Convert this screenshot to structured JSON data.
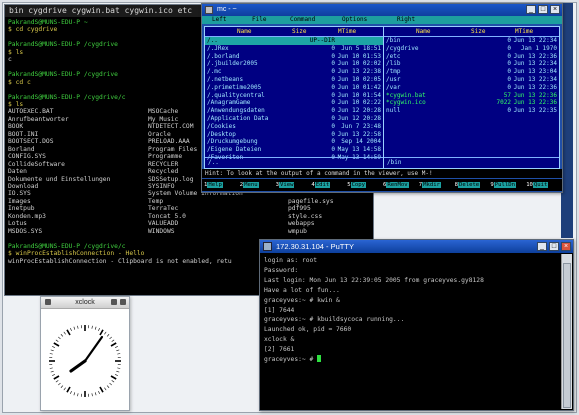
{
  "cygwin": {
    "title": "bin  cygdrive  cygwin.bat  cygwin.ico  etc",
    "lines": [
      "PakrandS@MUNS-EDU-P ~",
      "$ cd cygdrive",
      "",
      "PakrandS@MUNS-EDU-P /cygdrive",
      "$ ls",
      "c",
      "",
      "PakrandS@MUNS-EDU-P /cygdrive",
      "$ cd c",
      "",
      "PakrandS@MUNS-EDU-P /cygdrive/c",
      "$ ls"
    ],
    "listing_left": [
      "AUTOEXEC.BAT",
      "Anrufbeantworter",
      "BOOK",
      "BOOT.INI",
      "BOOTSECT.DOS",
      "Borland",
      "CONFIG.SYS",
      "CollideSoftware",
      "Daten",
      "Dokumente und Einstellungen",
      "Download",
      "IO.SYS",
      "Images",
      "Inetpub",
      "Konden.mp3",
      "Lotus",
      "MSDOS.SYS"
    ],
    "listing_right": [
      "MSOCache",
      "My Music",
      "NTDETECT.COM",
      "Oracle",
      "PRELOAD.AAA",
      "Program Files",
      "Programme",
      "RECYCLER",
      "Recycled",
      "SDSSetup.log",
      "SYSINFO",
      "System Volume Information",
      "Temp",
      "TerraTec",
      "Toncat 5.0",
      "VALUEADD",
      "WINDOWS"
    ],
    "listing_extra": [
      "pagefile.sys",
      "pdf995",
      "style.css",
      "webapps",
      "wmpub"
    ],
    "tail": [
      "",
      "PakrandS@MUNS-EDU-P /cygdrive/c",
      "$ winProcEstablishConnection - Hello",
      "winProcEstablishConnection - Clipboard is not enabled, retu"
    ]
  },
  "mc": {
    "title": "mc - ~",
    "menu": [
      "Left",
      "File",
      "Command",
      "Options",
      "Right"
    ],
    "left": {
      "headers": [
        "Name",
        "Size",
        "MTime"
      ],
      "rows": [
        [
          "/..",
          "UP--DIR",
          ""
        ],
        [
          "/.JRex",
          "0",
          "Jun  5 18:51"
        ],
        [
          "/.borland",
          "0",
          "Jun 10 01:53"
        ],
        [
          "/.jbuilder2005",
          "0",
          "Jun 10 02:02"
        ],
        [
          "/.mc",
          "0",
          "Jun 13 22:38"
        ],
        [
          "/.netbeans",
          "0",
          "Jun 10 02:05"
        ],
        [
          "/.primetime2005",
          "0",
          "Jun 10 01:42"
        ],
        [
          "/.qualitycentral",
          "0",
          "Jun 10 01:54"
        ],
        [
          "/AnagramGame",
          "0",
          "Jun 10 02:22"
        ],
        [
          "/Anwendungsdaten",
          "0",
          "Jun 12 20:28"
        ],
        [
          "/Application Data",
          "0",
          "Jun 12 20:28"
        ],
        [
          "/Cookies",
          "0",
          "Jun  7 23:48"
        ],
        [
          "/Desktop",
          "0",
          "Jun 13 22:58"
        ],
        [
          "/Druckumgebung",
          "0",
          "Sep 14  2004"
        ],
        [
          "/Eigene Dateien",
          "0",
          "May 13 14:58"
        ],
        [
          "/Favoriten",
          "0",
          "May 13 14:59"
        ]
      ],
      "footer": "/.."
    },
    "right": {
      "headers": [
        "Name",
        "Size",
        "MTime"
      ],
      "rows": [
        [
          "/bin",
          "0",
          "Jun 13 22:34"
        ],
        [
          "/cygdrive",
          "0",
          "Jan  1  1970"
        ],
        [
          "/etc",
          "0",
          "Jun 13 22:36"
        ],
        [
          "/lib",
          "0",
          "Jun 13 22:34"
        ],
        [
          "/tmp",
          "0",
          "Jun 13 23:04"
        ],
        [
          "/usr",
          "0",
          "Jun 13 22:34"
        ],
        [
          "/var",
          "0",
          "Jun 13 22:36"
        ],
        [
          "*cygwin.bat",
          "57",
          "Jun 13 22:36"
        ],
        [
          "*cygwin.ico",
          "7022",
          "Jun 13 22:36"
        ],
        [
          "null",
          "0",
          "Jun 13 22:35"
        ]
      ],
      "footer": "/bin"
    },
    "hint": "Hint: To look at the output of a command in the viewer, use M-!",
    "fkeys": [
      [
        "1",
        "Help"
      ],
      [
        "2",
        "Menu"
      ],
      [
        "3",
        "View"
      ],
      [
        "4",
        "Edit"
      ],
      [
        "5",
        "Copy"
      ],
      [
        "6",
        "RenMov"
      ],
      [
        "7",
        "Mkdir"
      ],
      [
        "8",
        "Delete"
      ],
      [
        "9",
        "PullDn"
      ],
      [
        "10",
        "Quit"
      ]
    ]
  },
  "putty": {
    "title": "172.30.31.104 - PuTTY",
    "lines": [
      "login as: root",
      "Password:",
      "Last login: Mon Jun 13 22:39:05 2005 from graceyves.gy8128",
      "Have a lot of fun...",
      "graceyves:~ # kwin &",
      "[1] 7644",
      "graceyves:~ # kbuildsycoca running...",
      "Launched ok, pid = 7660",
      "xclock &",
      "[2] 7661",
      "graceyves:~ # "
    ]
  },
  "xclock": {
    "title": "xclock"
  },
  "colors": {
    "prompt_green": "#3fcf3f",
    "mc_blue": "#000082",
    "mc_cyan": "#1da5a5",
    "titlebar_blue": "#0f3f9e"
  }
}
